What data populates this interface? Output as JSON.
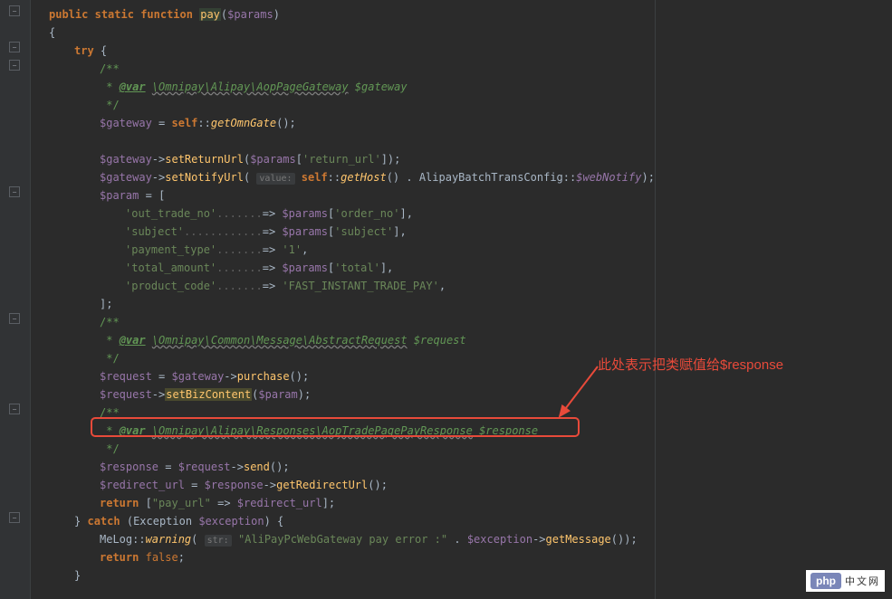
{
  "code": {
    "l1_public": "public",
    "l1_static": "static",
    "l1_function": "function",
    "l1_fn": "pay",
    "l1_params": "$params",
    "l3_try": "try",
    "doc1_open": "/**",
    "doc1_tag": "@var",
    "doc1_class": "\\Omnipay\\Alipay\\AopPageGateway",
    "doc1_var": "$gateway",
    "doc_close": " */",
    "l7_var": "$gateway",
    "l7_self": "self",
    "l7_fn": "getOmnGate",
    "l9_var": "$gateway",
    "l9_fn": "setReturnUrl",
    "l9_params": "$params",
    "l9_key": "'return_url'",
    "l10_var": "$gateway",
    "l10_fn": "setNotifyUrl",
    "l10_hint": "value:",
    "l10_self": "self",
    "l10_fn2": "getHost",
    "l10_class": "AlipayBatchTransConfig",
    "l10_prop": "$webNotify",
    "l11_var": "$param",
    "arr1_key": "'out_trade_no'",
    "arr1_dots": ".......",
    "arr1_params": "$params",
    "arr1_val": "'order_no'",
    "arr2_key": "'subject'",
    "arr2_dots": "............",
    "arr2_params": "$params",
    "arr2_val": "'subject'",
    "arr3_key": "'payment_type'",
    "arr3_dots": ".......",
    "arr3_val": "'1'",
    "arr4_key": "'total_amount'",
    "arr4_dots": ".......",
    "arr4_params": "$params",
    "arr4_val": "'total'",
    "arr5_key": "'product_code'",
    "arr5_dots": ".......",
    "arr5_val": "'FAST_INSTANT_TRADE_PAY'",
    "doc2_tag": "@var",
    "doc2_class": "\\Omnipay\\Common\\Message\\AbstractRequest",
    "doc2_var": "$request",
    "l20_var": "$request",
    "l20_gw": "$gateway",
    "l20_fn": "purchase",
    "l21_var": "$request",
    "l21_fn": "setBizContent",
    "l21_param": "$param",
    "doc3_tag": "@var",
    "doc3_class": "\\Omnipay\\Alipay\\Responses\\AopTradePagePayResponse",
    "doc3_var": "$response",
    "l25_var": "$response",
    "l25_req": "$request",
    "l25_fn": "send",
    "l26_var": "$redirect_url",
    "l26_resp": "$response",
    "l26_fn": "getRedirectUrl",
    "l27_return": "return",
    "l27_key": "\"pay_url\"",
    "l27_val": "$redirect_url",
    "l28_catch": "catch",
    "l28_exc": "Exception",
    "l28_var": "$exception",
    "l29_class": "MeLog",
    "l29_fn": "warning",
    "l29_hint": "str:",
    "l29_str": "\"AliPayPcWebGateway pay error :\"",
    "l29_var": "$exception",
    "l29_fn2": "getMessage",
    "l30_return": "return",
    "l30_false": "false"
  },
  "annotation": {
    "text": "此处表示把类赋值给$response"
  },
  "watermark": {
    "php": "php",
    "cn": "中文网"
  }
}
